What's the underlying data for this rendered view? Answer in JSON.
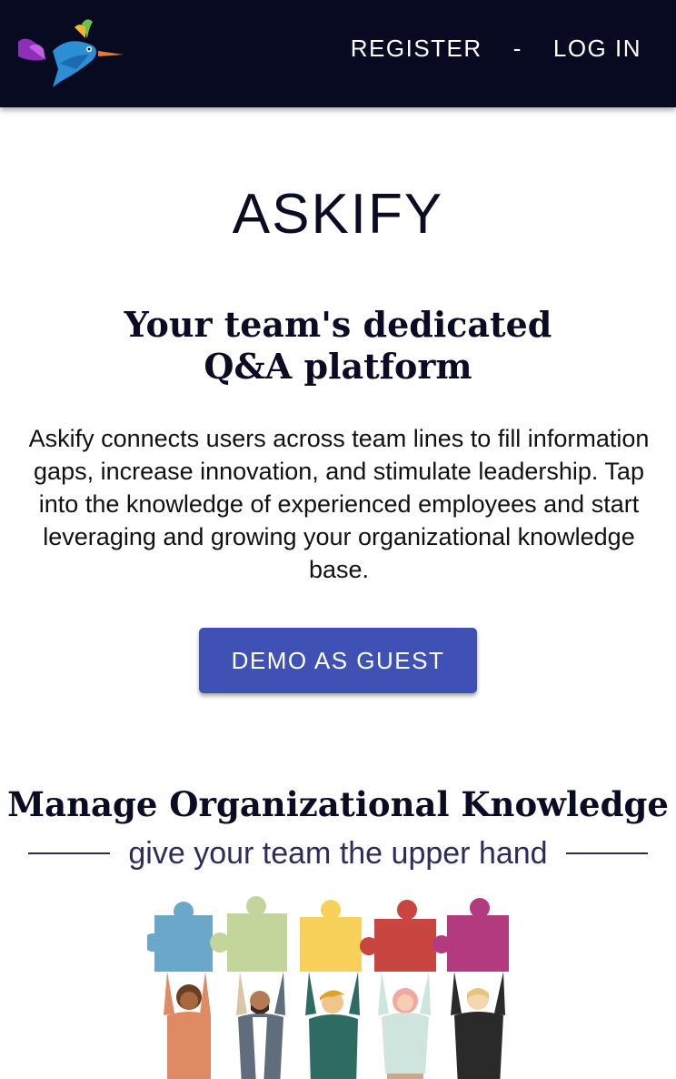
{
  "nav": {
    "logo_icon": "hummingbird-logo-icon",
    "register_label": "REGISTER",
    "separator": "-",
    "login_label": "LOG IN"
  },
  "hero": {
    "brand": "ASKIFY",
    "tagline": "Your team's dedicated Q&A platform",
    "description": "Askify connects users across team lines to fill information gaps, increase innovation, and stimulate leadership. Tap into the knowledge of experienced employees and start leveraging and growing your organizational knowledge base.",
    "demo_button_label": "DEMO AS GUEST"
  },
  "features": {
    "title": "Manage Organizational Knowledge",
    "subtitle": "give your team the upper hand",
    "illustration_icon": "team-puzzle-illustration"
  },
  "colors": {
    "navbar_bg": "#080a22",
    "primary_button": "#3f51b5",
    "heading_text": "#0a0c24",
    "puzzle_colors": [
      "#6aa7c8",
      "#c4d59c",
      "#f8d15a",
      "#c9453f",
      "#b33a7e"
    ]
  }
}
